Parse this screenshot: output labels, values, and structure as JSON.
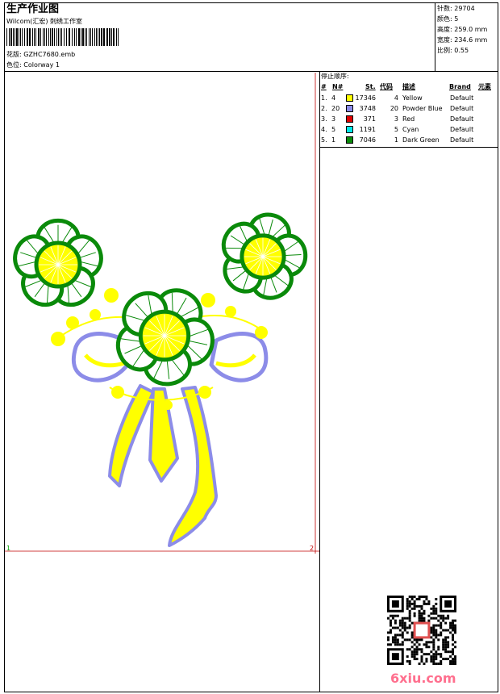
{
  "header": {
    "title": "生产作业图",
    "subtitle": "Wilcom(汇宏) 刺绣工作室",
    "design_file_label": "花版:",
    "design_file": "GZHC7680.emb",
    "colorway_label": "色位:",
    "colorway": "Colorway 1"
  },
  "stats": {
    "stitches_label": "针数:",
    "stitches": "29704",
    "colors_label": "颜色:",
    "colors": "5",
    "height_label": "高度:",
    "height": "259.0 mm",
    "width_label": "宽度:",
    "width": "234.6 mm",
    "scale_label": "比例:",
    "scale": "0.55"
  },
  "stop_sequence": {
    "title": "停止顺序:",
    "columns": [
      "#",
      "N#",
      "St.",
      "代码",
      "描述",
      "Brand",
      "元素"
    ],
    "rows": [
      {
        "seq": "1.",
        "needle": "4",
        "color": "#ffff00",
        "stitches": "17346",
        "code": "4",
        "description": "Yellow",
        "brand": "Default"
      },
      {
        "seq": "2.",
        "needle": "20",
        "color": "#8c8ce8",
        "stitches": "3748",
        "code": "20",
        "description": "Powder Blue",
        "brand": "Default"
      },
      {
        "seq": "3.",
        "needle": "3",
        "color": "#e00000",
        "stitches": "371",
        "code": "3",
        "description": "Red",
        "brand": "Default"
      },
      {
        "seq": "4.",
        "needle": "5",
        "color": "#00e8e8",
        "stitches": "1191",
        "code": "5",
        "description": "Cyan",
        "brand": "Default"
      },
      {
        "seq": "5.",
        "needle": "1",
        "color": "#0a8a0a",
        "stitches": "7046",
        "code": "1",
        "description": "Dark Green",
        "brand": "Default"
      }
    ]
  },
  "marks": {
    "left": "1",
    "right": "2"
  },
  "watermark": "6xiu.com",
  "colors": {
    "green": "#0a8a0a",
    "yellow": "#ffff00",
    "blue": "#8c8ce8",
    "guide_red": "#c00000"
  }
}
